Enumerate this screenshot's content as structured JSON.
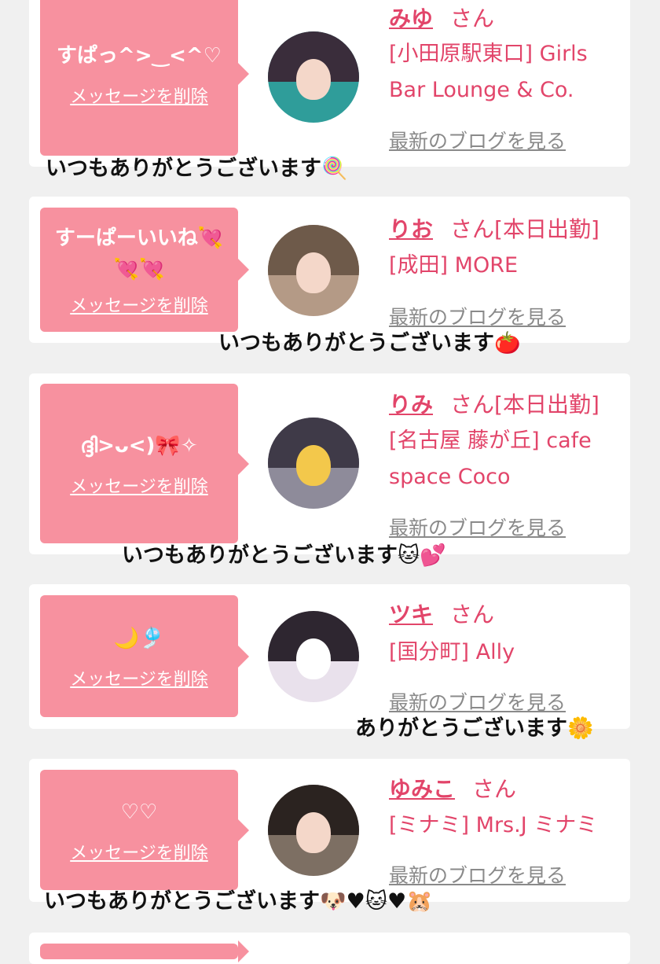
{
  "delete_label": "メッセージを削除",
  "san": "さん",
  "blog_label": "最新のブログを見る",
  "cards": [
    {
      "message": "すぱっ^>‿<^♡",
      "name": "みゆ",
      "status": "",
      "shop": "[小田原駅東口] Girls Bar Lounge & Co.",
      "reply": "いつもありがとうございます🍭"
    },
    {
      "message": "すーぱーいいね💘💘💘",
      "name": "りお",
      "status": "[本日出勤]",
      "shop": "[成田] MORE",
      "reply": "いつもありがとうございます🍅"
    },
    {
      "message": "ദ്ദി>ᴗ<)🎀✧",
      "name": "りみ",
      "status": "[本日出勤]",
      "shop": "[名古屋 藤が丘] cafe space Coco",
      "reply": "いつもありがとうございます🐱💕"
    },
    {
      "message": "🌙🎐",
      "name": "ツキ",
      "status": "",
      "shop": "[国分町] Ally",
      "reply": "ありがとうございます🌼"
    },
    {
      "message": "♡♡",
      "name": "ゆみこ",
      "status": "",
      "shop": "[ミナミ] Mrs.J ミナミ",
      "reply": "いつもありがとうございます🐶♥🐱♥🐹"
    }
  ],
  "colors": {
    "accent": "#e2456a",
    "bubble": "#f7919f",
    "background": "#f0f0f0"
  }
}
